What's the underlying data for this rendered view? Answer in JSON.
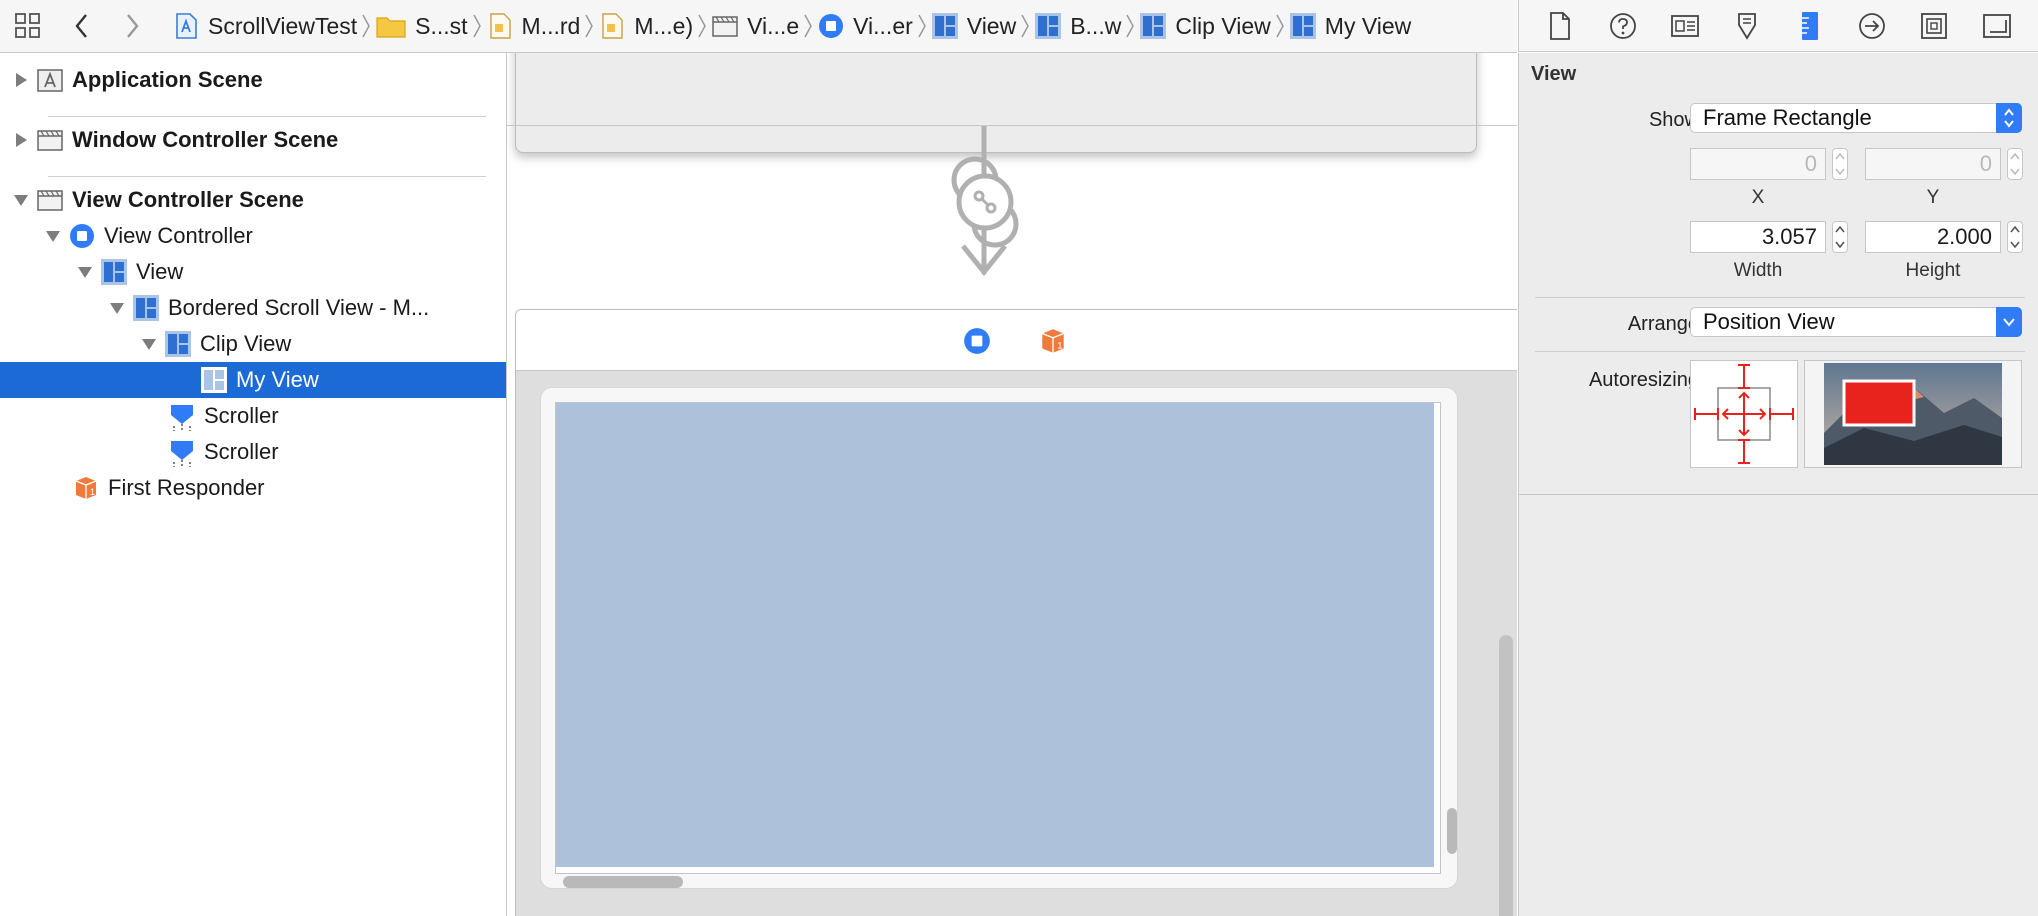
{
  "jump_bar": {
    "crumbs": [
      {
        "label": "ScrollViewTest",
        "icon": "project-icon"
      },
      {
        "label": "S...st",
        "icon": "folder-icon"
      },
      {
        "label": "M...rd",
        "icon": "storyboard-icon"
      },
      {
        "label": "M...e)",
        "icon": "storyboard-icon"
      },
      {
        "label": "Vi...e",
        "icon": "scene-icon"
      },
      {
        "label": "Vi...er",
        "icon": "view-controller-icon"
      },
      {
        "label": "View",
        "icon": "view-icon"
      },
      {
        "label": "B...w",
        "icon": "view-icon"
      },
      {
        "label": "Clip View",
        "icon": "view-icon"
      },
      {
        "label": "My View",
        "icon": "view-icon"
      }
    ]
  },
  "inspector_toolbar": {
    "icons": [
      "file-inspector-icon",
      "help-inspector-icon",
      "identity-inspector-icon",
      "attributes-inspector-icon",
      "size-inspector-icon",
      "connections-inspector-icon",
      "bindings-inspector-icon",
      "effects-inspector-icon"
    ],
    "active": "size-inspector-icon"
  },
  "navigator": {
    "items": [
      {
        "label": "Application Scene",
        "level": 0,
        "bold": true,
        "expanded": false,
        "icon": "scene-icon"
      },
      {
        "label": "Window Controller Scene",
        "level": 0,
        "bold": true,
        "expanded": false,
        "icon": "scene-icon"
      },
      {
        "label": "View Controller Scene",
        "level": 0,
        "bold": true,
        "expanded": true,
        "icon": "scene-icon"
      },
      {
        "label": "View Controller",
        "level": 1,
        "expanded": true,
        "icon": "view-controller-icon"
      },
      {
        "label": "View",
        "level": 2,
        "expanded": true,
        "icon": "view-icon"
      },
      {
        "label": "Bordered Scroll View - M...",
        "level": 3,
        "expanded": true,
        "icon": "view-icon"
      },
      {
        "label": "Clip View",
        "level": 4,
        "expanded": true,
        "icon": "view-icon"
      },
      {
        "label": "My View",
        "level": 5,
        "selected": true,
        "icon": "view-icon"
      },
      {
        "label": "Scroller",
        "level": 4,
        "icon": "scroller-icon"
      },
      {
        "label": "Scroller",
        "level": 4,
        "icon": "scroller-icon"
      },
      {
        "label": "First Responder",
        "level": 1,
        "icon": "first-responder-icon"
      }
    ]
  },
  "inspector": {
    "section_title": "View",
    "show_label": "Show",
    "show_value": "Frame Rectangle",
    "x_value": "0",
    "y_value": "0",
    "x_label": "X",
    "y_label": "Y",
    "width_value": "3.057",
    "height_value": "2.000",
    "width_label": "Width",
    "height_label": "Height",
    "arrange_label": "Arrange",
    "arrange_value": "Position View",
    "autoresizing_label": "Autoresizing"
  },
  "colors": {
    "accent": "#2f7cf6",
    "selection": "#1b6ad6",
    "view_fill": "#adc2da",
    "autoresize_red": "#e8231d"
  }
}
